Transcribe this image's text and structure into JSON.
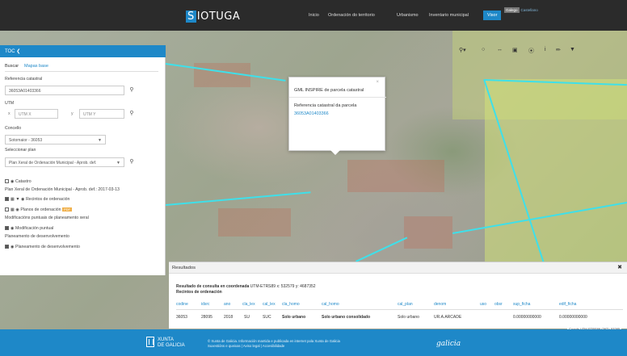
{
  "app": {
    "logo_letter": "S",
    "logo_rest": "IOTUGA"
  },
  "nav": {
    "items": [
      "Inicio",
      "Ordenación do territorio",
      "Urbanismo",
      "Inventario municipal",
      "Visor"
    ],
    "lang_active": "Galego",
    "lang_alt": "Castellano"
  },
  "toc": {
    "header": "TOC",
    "tabs": [
      "Buscar",
      "Mapas base"
    ],
    "ref_label": "Referencia catastral",
    "ref_value": "36053A01403366",
    "utm_label": "UTM",
    "utm_x_placeholder": "UTM X",
    "utm_y_placeholder": "UTM Y",
    "utm_x_letter": "x",
    "utm_y_letter": "y",
    "concello_label": "Concello",
    "concello_value": "Sotomaior - 36053",
    "plan_label": "Seleccionar plan",
    "plan_value": "Plan Xeral de Ordenación Municipal - Aprob. def.",
    "layers": {
      "catastro": "Catastro",
      "plan_full": "Plan Xeral de Ordenación Municipal - Aprob. def.: 2017-03-13",
      "recintos": "Recintos de ordenación",
      "planos": "Planos de ordenación",
      "planos_tag": "PDF",
      "modificacions": "Modificacións puntuais de planeamento xeral",
      "modificacion": "Modificación puntual",
      "planeamento": "Planeamento de desenvolvemento",
      "planeamento2": "Planeamento de desenvolvemento"
    }
  },
  "toolbar": {
    "icons": [
      "zoom-icon",
      "target-icon",
      "measure-icon",
      "layers-icon",
      "eye-icon",
      "info-icon",
      "pen-icon",
      "download-icon"
    ]
  },
  "popup": {
    "title": "GML INSPIRE de parcela catastral",
    "label": "Referencia catastral da parcela",
    "link": "36053A01403366"
  },
  "results": {
    "title": "Resultados",
    "desc_prefix": "Resultado de consulta en coordenada",
    "desc_coord": " UTM-ETRS89 x: 532579 y: 4687352",
    "desc_line2": "Recintos de ordenación",
    "columns": [
      "codine",
      "idsrc",
      "ano",
      "cla_lex",
      "cal_lex",
      "cla_homo",
      "cal_homo",
      "cal_plan",
      "denom",
      "uso",
      "obsr",
      "sup_ficha",
      "edif_ficha"
    ],
    "rows": [
      [
        "36053",
        "28095",
        "2018",
        "SU",
        "SUC",
        "Solo urbano",
        "Solo urbano consolidado",
        "Solo urbano",
        "UR.A.ARCADE",
        "",
        "",
        "0.00000000000",
        "0.00000000000"
      ]
    ],
    "coords_readout": "Coords UTM-ETRS89 (29T): 53285"
  },
  "footer": {
    "xunta_line1": "XUNTA",
    "xunta_line2": "DE GALICIA",
    "legal_line1": "© Xunta de Galicia. Información mantida e publicada en internet pola Xunta de Galicia",
    "legal_line2": "Suxestións e queixas | Aviso legal | Accesibilidade",
    "galicia": "galicia"
  },
  "colors": {
    "accent": "#1e88c8",
    "header": "#2b2b2b",
    "parcel": "#3ee0ea",
    "tag": "#f0b04a"
  }
}
